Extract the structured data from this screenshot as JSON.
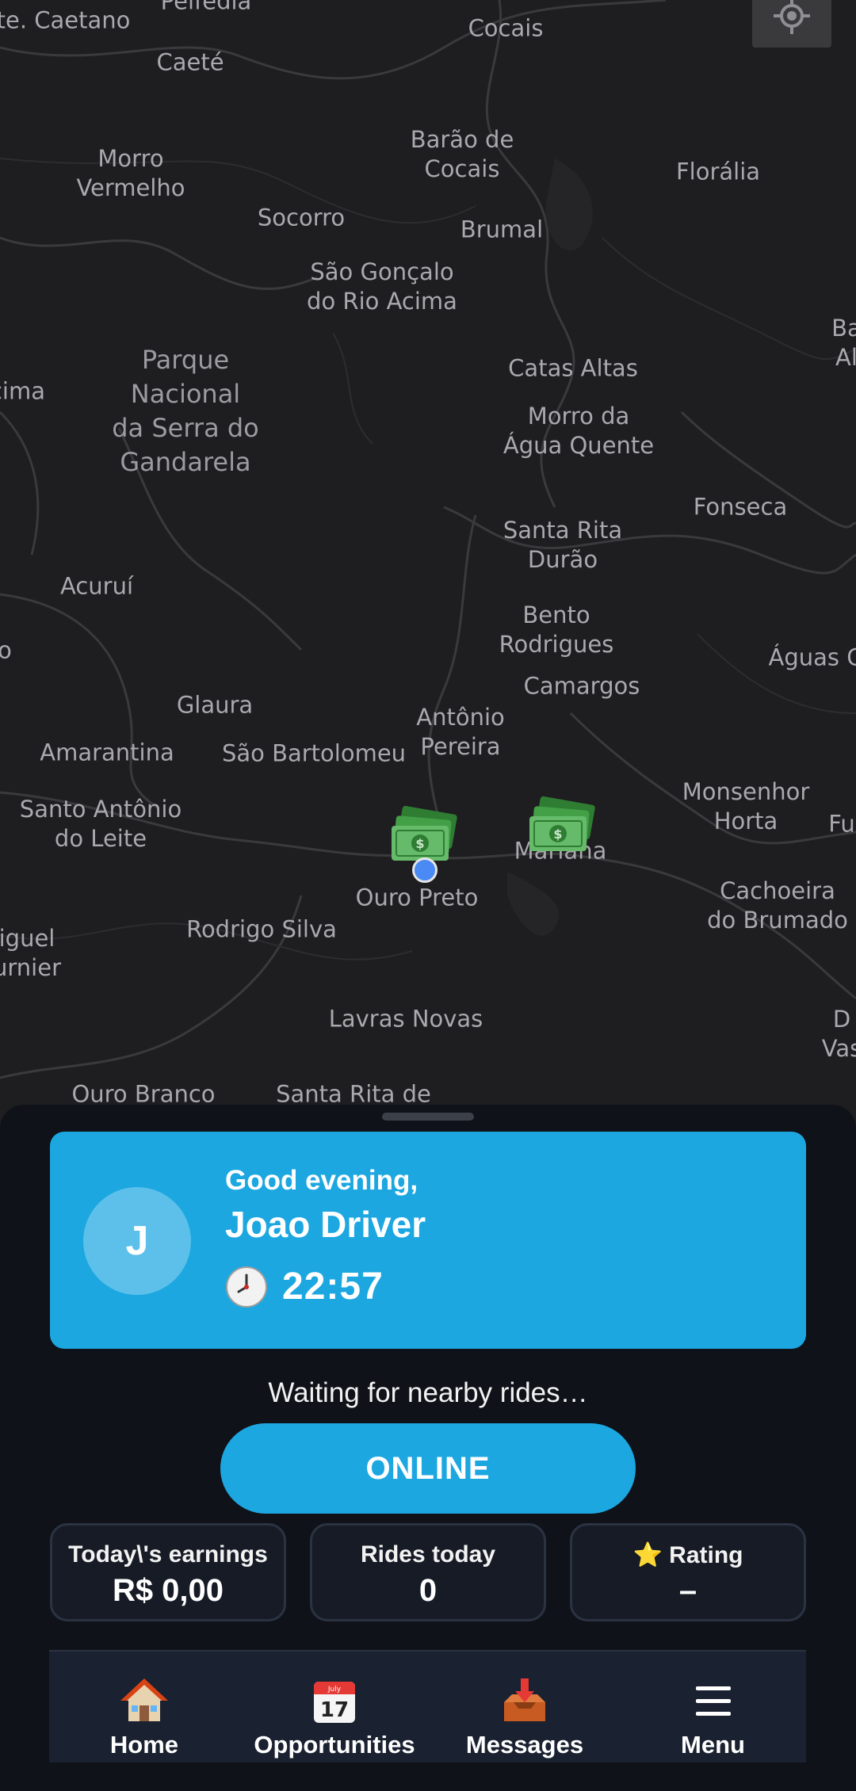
{
  "map": {
    "places": [
      {
        "label": "te. Caetano"
      },
      {
        "label": "Pelfedia"
      },
      {
        "label": "Cocais"
      },
      {
        "label": "Caeté"
      },
      {
        "label": "Morro\nVermelho"
      },
      {
        "label": "Barão de\nCocais"
      },
      {
        "label": "Florália"
      },
      {
        "label": "Socorro"
      },
      {
        "label": "Brumal"
      },
      {
        "label": "São Gonçalo\ndo Rio Acima"
      },
      {
        "label": "Parque\nNacional\nda Serra do\nGandarela",
        "park": true
      },
      {
        "label": "cima"
      },
      {
        "label": "Catas Altas"
      },
      {
        "label": "Ba\nAl"
      },
      {
        "label": "Morro da\nÁgua Quente"
      },
      {
        "label": "Fonseca"
      },
      {
        "label": "Santa Rita\nDurão"
      },
      {
        "label": "Acuruí"
      },
      {
        "label": "Bento\nRodrigues"
      },
      {
        "label": "o"
      },
      {
        "label": "Águas C"
      },
      {
        "label": "Camargos"
      },
      {
        "label": "Glaura"
      },
      {
        "label": "Antônio\nPereira"
      },
      {
        "label": "Amarantina"
      },
      {
        "label": "São Bartolomeu"
      },
      {
        "label": "Monsenhor\nHorta"
      },
      {
        "label": "Santo Antônio\ndo Leite"
      },
      {
        "label": "Mariana"
      },
      {
        "label": "Fu"
      },
      {
        "label": "Ouro Preto"
      },
      {
        "label": "Cachoeira\ndo Brumado"
      },
      {
        "label": "Rodrigo Silva"
      },
      {
        "label": "iguel\nurnier"
      },
      {
        "label": "Lavras Novas"
      },
      {
        "label": "D\nVas"
      },
      {
        "label": "Ouro Branco"
      },
      {
        "label": "Santa Rita de"
      }
    ],
    "locate_icon": "crosshair-icon",
    "marker_icon": "money-stack-icon"
  },
  "greeting": {
    "salutation": "Good evening,",
    "driver_name": "Joao Driver",
    "avatar_initial": "J",
    "time": "22:57",
    "time_icon": "clock-icon"
  },
  "status": {
    "text": "Waiting for nearby rides…",
    "online_label": "ONLINE"
  },
  "stats": [
    {
      "label": "Today\\'s earnings",
      "value": "R$ 0,00"
    },
    {
      "label": "Rides today",
      "value": "0"
    },
    {
      "label": "⭐ Rating",
      "value": "–"
    }
  ],
  "nav": [
    {
      "label": "Home",
      "icon": "house-icon"
    },
    {
      "label": "Opportunities",
      "icon": "calendar-icon"
    },
    {
      "label": "Messages",
      "icon": "inbox-tray-icon"
    },
    {
      "label": "Menu",
      "icon": "hamburger-icon"
    }
  ],
  "colors": {
    "accent": "#1ca7e1",
    "sheet_bg": "#0f1218",
    "map_bg": "#1e1e20",
    "user_dot": "#4a8af4"
  }
}
